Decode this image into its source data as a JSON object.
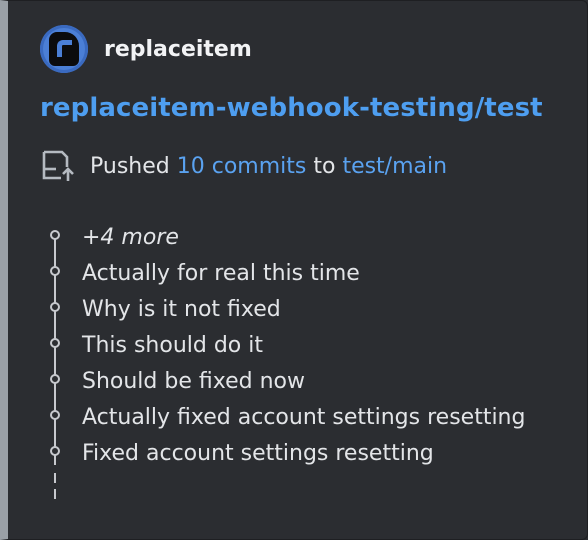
{
  "embed": {
    "author": "replaceitem",
    "title": "replaceitem-webhook-testing/test",
    "pushed": {
      "prefix": "Pushed",
      "commits_link": "10 commits",
      "to": "to",
      "branch_link": "test/main"
    },
    "commits": [
      {
        "text": "+4 more",
        "italic": true
      },
      {
        "text": "Actually for real this time"
      },
      {
        "text": "Why is it not fixed"
      },
      {
        "text": "This should do it"
      },
      {
        "text": "Should be fixed now"
      },
      {
        "text": "Actually fixed account settings resetting"
      },
      {
        "text": "Fixed account settings resetting"
      }
    ]
  },
  "colors": {
    "background": "#2b2d31",
    "sidebar": "#9aa0a6",
    "link": "#4e9ef0",
    "text": "#e3e5e8"
  },
  "icons": {
    "avatar": "avatar-r-icon",
    "push": "git-push-icon",
    "commit": "commit-dot-icon"
  }
}
